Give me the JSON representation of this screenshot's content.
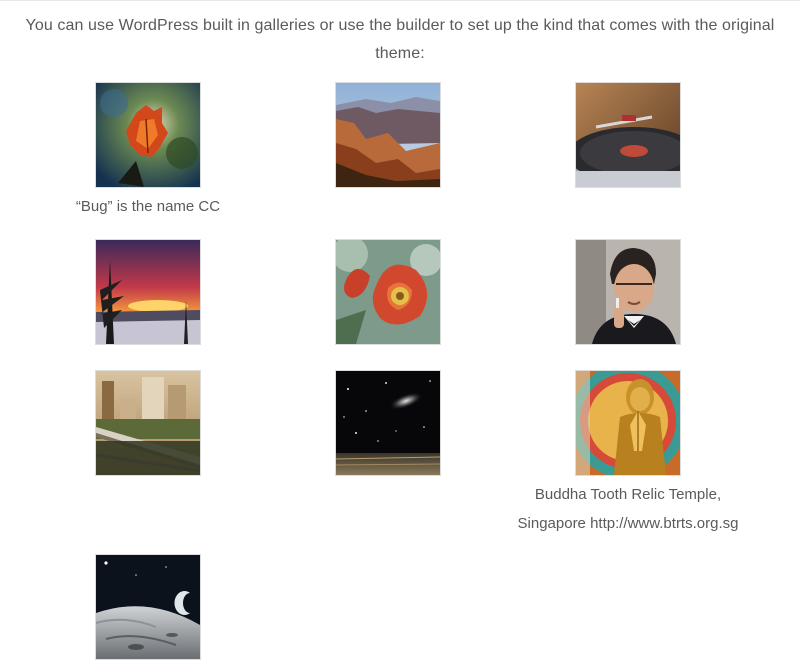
{
  "intro_text": "You can use WordPress built in galleries or use the builder to set up the kind that comes with the original theme:",
  "gallery": {
    "items": [
      {
        "name": "leaf",
        "caption": "“Bug” is the name CC"
      },
      {
        "name": "canyon",
        "caption": ""
      },
      {
        "name": "turntable",
        "caption": ""
      },
      {
        "name": "sunset",
        "caption": ""
      },
      {
        "name": "flower",
        "caption": ""
      },
      {
        "name": "portrait",
        "caption": ""
      },
      {
        "name": "city-bridge",
        "caption": ""
      },
      {
        "name": "galaxy",
        "caption": ""
      },
      {
        "name": "buddha",
        "caption": "Buddha Tooth Relic Temple,\nSingapore http://www.btrts.org.sg"
      },
      {
        "name": "moon",
        "caption": ""
      }
    ]
  },
  "colors": {
    "text": "#5a5a5a",
    "thumb_border": "#dcdcdc"
  }
}
